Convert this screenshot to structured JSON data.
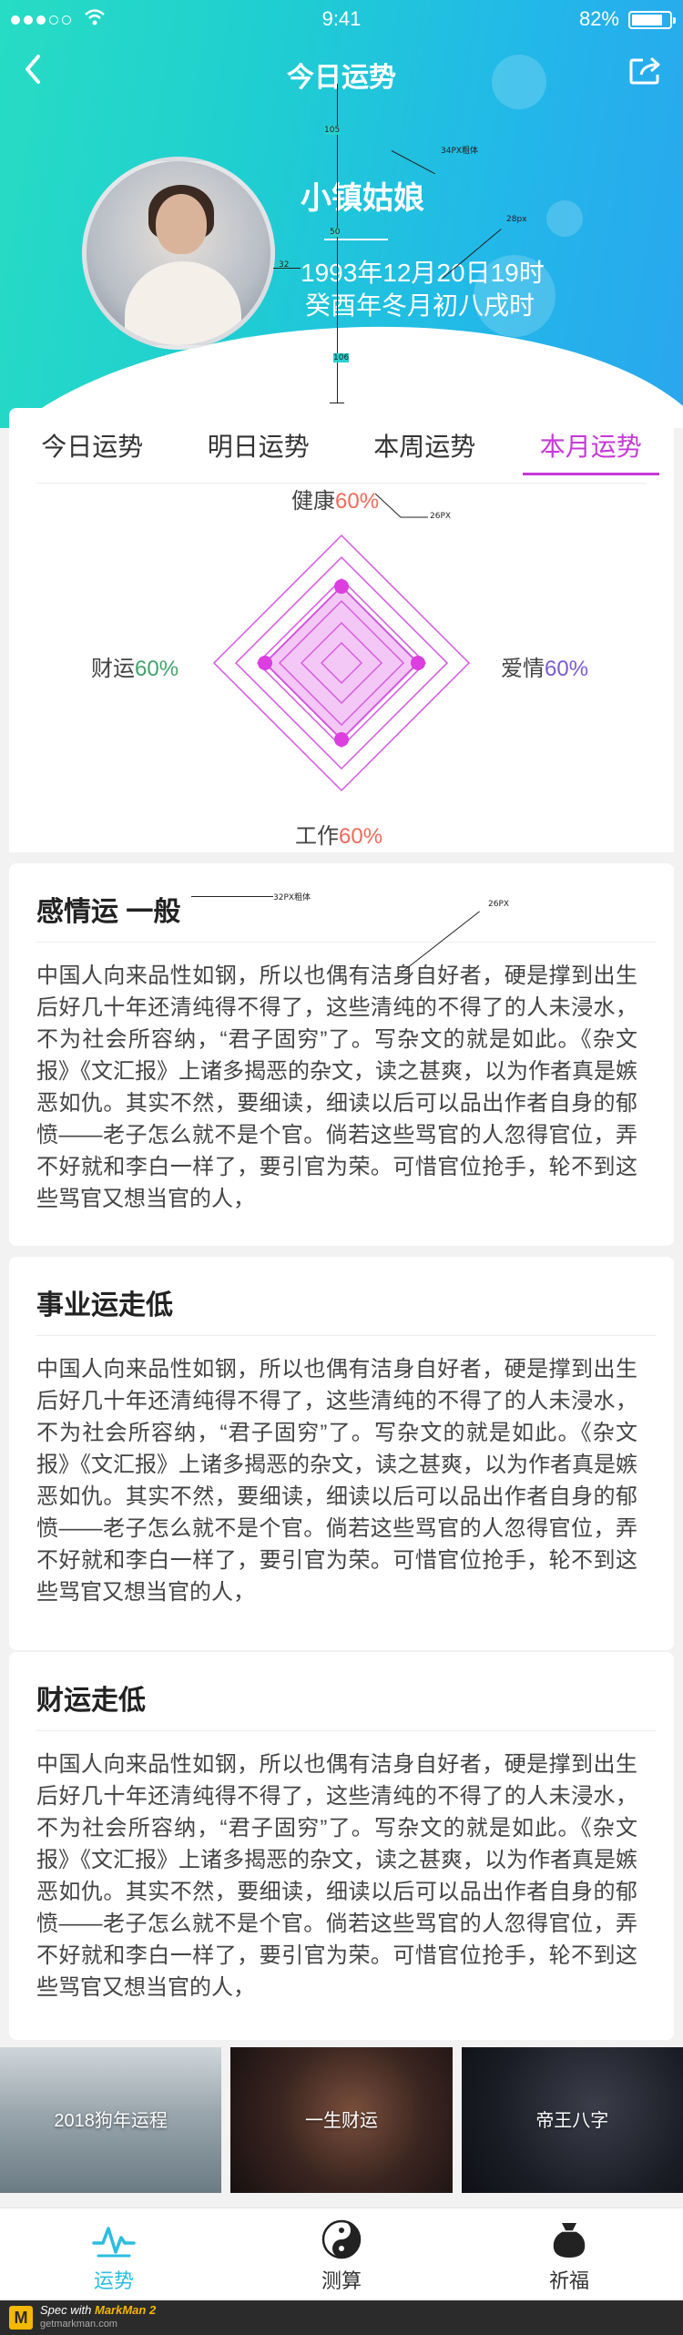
{
  "status_bar": {
    "time": "9:41",
    "battery_percent": "82%",
    "battery_level": 0.82
  },
  "nav": {
    "title": "今日运势"
  },
  "user": {
    "name": "小镇姑娘",
    "birth": "1993年12月20日19时",
    "lunar": "癸酉年冬月初八戌时"
  },
  "tabs": [
    {
      "label": "今日运势",
      "active": false
    },
    {
      "label": "明日运势",
      "active": false
    },
    {
      "label": "本周运势",
      "active": false
    },
    {
      "label": "本月运势",
      "active": true
    }
  ],
  "radar": {
    "health": {
      "label": "健康",
      "value": "60%"
    },
    "love": {
      "label": "爱情",
      "value": "60%"
    },
    "work": {
      "label": "工作",
      "value": "60%"
    },
    "wealth": {
      "label": "财运",
      "value": "60%"
    }
  },
  "sections": [
    {
      "title": "感情运 一般",
      "text": "中国人向来品性如钢，所以也偶有洁身自好者，硬是撑到出生后好几十年还清纯得不得了，这些清纯的不得了的人未浸水，不为社会所容纳，“君子固穷”了。写杂文的就是如此。《杂文报》《文汇报》上诸多揭恶的杂文，读之甚爽，以为作者真是嫉恶如仇。其实不然，要细读，细读以后可以品出作者自身的郁愤——老子怎么就不是个官。倘若这些骂官的人忽得官位，弄不好就和李白一样了，要引官为荣。可惜官位抢手，轮不到这些骂官又想当官的人，"
    },
    {
      "title": "事业运走低",
      "text": "中国人向来品性如钢，所以也偶有洁身自好者，硬是撑到出生后好几十年还清纯得不得了，这些清纯的不得了的人未浸水，不为社会所容纳，“君子固穷”了。写杂文的就是如此。《杂文报》《文汇报》上诸多揭恶的杂文，读之甚爽，以为作者真是嫉恶如仇。其实不然，要细读，细读以后可以品出作者自身的郁愤——老子怎么就不是个官。倘若这些骂官的人忽得官位，弄不好就和李白一样了，要引官为荣。可惜官位抢手，轮不到这些骂官又想当官的人，"
    },
    {
      "title": "财运走低",
      "text": "中国人向来品性如钢，所以也偶有洁身自好者，硬是撑到出生后好几十年还清纯得不得了，这些清纯的不得了的人未浸水，不为社会所容纳，“君子固穷”了。写杂文的就是如此。《杂文报》《文汇报》上诸多揭恶的杂文，读之甚爽，以为作者真是嫉恶如仇。其实不然，要细读，细读以后可以品出作者自身的郁愤——老子怎么就不是个官。倘若这些骂官的人忽得官位，弄不好就和李白一样了，要引官为荣。可惜官位抢手，轮不到这些骂官又想当官的人，"
    }
  ],
  "banners": [
    {
      "label": "2018狗年运程"
    },
    {
      "label": "一生财运"
    },
    {
      "label": "帝王八字"
    }
  ],
  "bottom_nav": [
    {
      "label": "运势",
      "icon": "pulse-icon",
      "active": true
    },
    {
      "label": "测算",
      "icon": "yin-yang-icon",
      "active": false
    },
    {
      "label": "祈福",
      "icon": "blessing-bag-icon",
      "active": false
    }
  ],
  "annotations": {
    "a105": "105",
    "a50": "50",
    "a32": "32",
    "a106": "106",
    "name_font": "34PX粗体",
    "birth_font": "28px",
    "radar_font": "26PX",
    "title_font": "32PX粗体",
    "body_font": "26PX"
  },
  "footer": {
    "spec_with": "Spec with",
    "brand": "MarkMan 2",
    "site": "getmarkman.com"
  },
  "colors": {
    "accent": "#c53ad6",
    "header_start": "#27dcc4",
    "header_end": "#2aa6ef",
    "active_nav": "#2bbde0"
  }
}
